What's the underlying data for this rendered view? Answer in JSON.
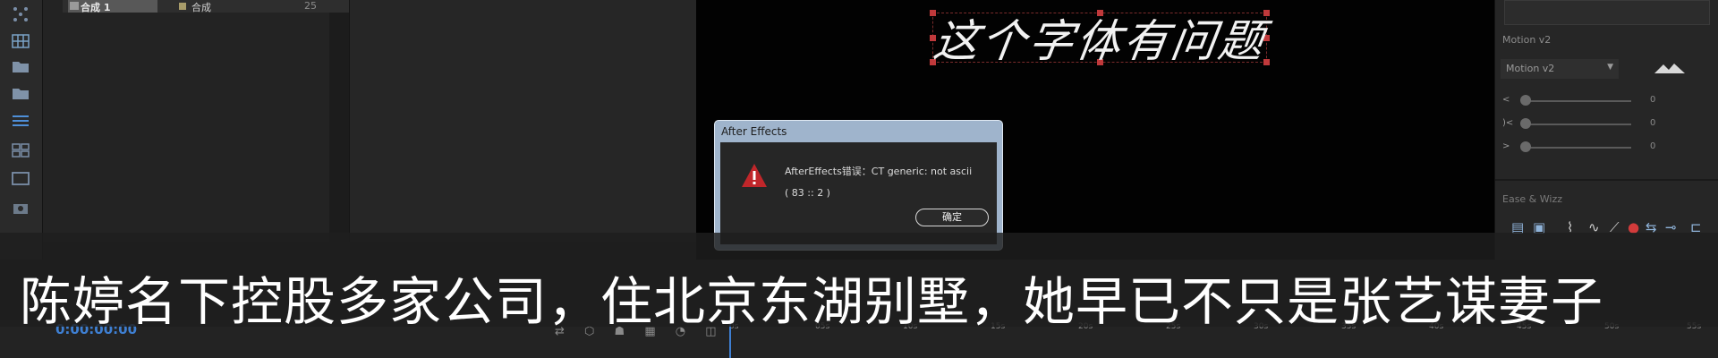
{
  "project_panel": {
    "item_name": "合成 1",
    "item_type": "合成",
    "item_size": "25"
  },
  "composition": {
    "text_layer": "这个字体有问题"
  },
  "dialog": {
    "title": "After Effects",
    "message": "AfterEffects错误：CT generic: not ascii",
    "code": "( 83 :: 2 )",
    "ok_label": "确定"
  },
  "right_panel": {
    "header": "Motion v2",
    "dropdown": "Motion v2",
    "sliders": [
      {
        "label": "<",
        "value": "0"
      },
      {
        "label": ")<",
        "value": "0"
      },
      {
        "label": ">",
        "value": "0"
      }
    ],
    "sub_header": "Ease & Wizz"
  },
  "timeline": {
    "timecode": "0:00:00:00",
    "ruler_labels": [
      "0s",
      "05s",
      "10s",
      "15s",
      "20s",
      "25s",
      "30s",
      "35s",
      "40s",
      "45s",
      "50s",
      "55s"
    ]
  },
  "subtitle": "陈婷名下控股多家公司，住北京东湖别墅，她早已不只是张艺谋妻子",
  "colors": {
    "timecode": "#3e7fd2",
    "warning": "#c0262a",
    "dialog_frame": "#9fb4cc"
  }
}
